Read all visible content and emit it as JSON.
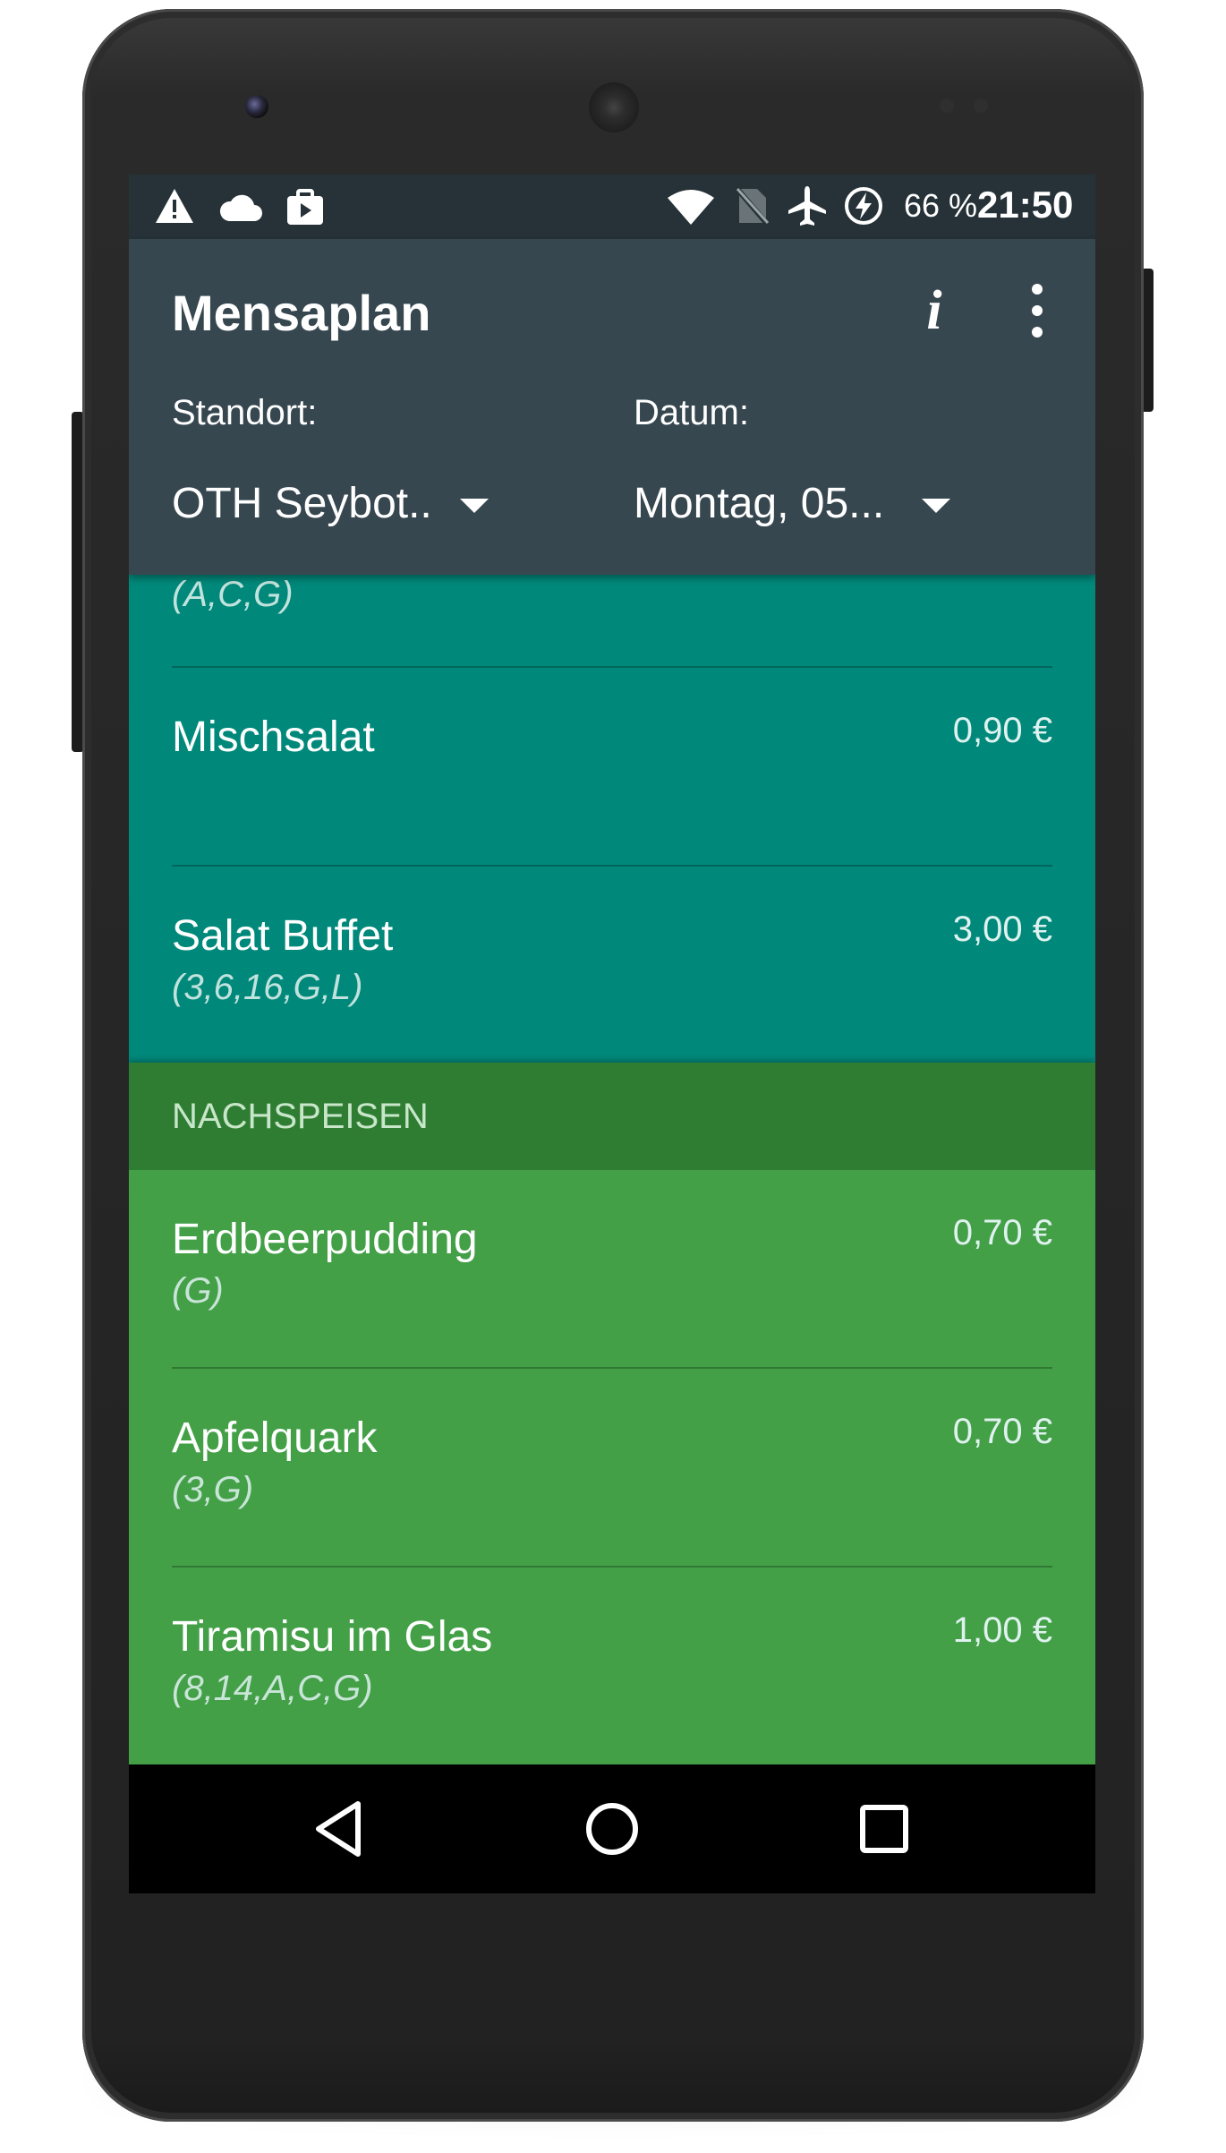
{
  "status_bar": {
    "left_icons": [
      "warning-icon",
      "cloud-icon",
      "briefcase-icon"
    ],
    "right_icons": [
      "wifi-icon",
      "no-sim-icon",
      "airplane-mode-icon",
      "battery-saver-icon"
    ],
    "battery": "66 %",
    "time": "21:50"
  },
  "toolbar": {
    "title": "Mensaplan",
    "info_icon": "info-icon",
    "overflow_icon": "more-vert-icon",
    "location_label": "Standort:",
    "location_value": "OTH Seybot..",
    "date_label": "Datum:",
    "date_value": "Montag, 05..."
  },
  "colors": {
    "statusbar": "#263238",
    "toolbar": "#37474f",
    "teal_section": "#00897b",
    "dessert_header": "#2e7d32",
    "dessert_section": "#43a047"
  },
  "menu": {
    "partial_item_allergens": "(A,C,G)",
    "salads": [
      {
        "name": "Mischsalat",
        "allergens": "",
        "price": "0,90 €"
      },
      {
        "name": "Salat Buffet",
        "allergens": "(3,6,16,G,L)",
        "price": "3,00 €"
      }
    ],
    "dessert_header": "NACHSPEISEN",
    "desserts": [
      {
        "name": "Erdbeerpudding",
        "allergens": "(G)",
        "price": "0,70 €"
      },
      {
        "name": "Apfelquark",
        "allergens": "(3,G)",
        "price": "0,70 €"
      },
      {
        "name": "Tiramisu im Glas",
        "allergens": "(8,14,A,C,G)",
        "price": "1,00 €"
      }
    ]
  },
  "nav_bar": {
    "back_icon": "back-icon",
    "home_icon": "home-icon",
    "recents_icon": "recents-icon"
  }
}
